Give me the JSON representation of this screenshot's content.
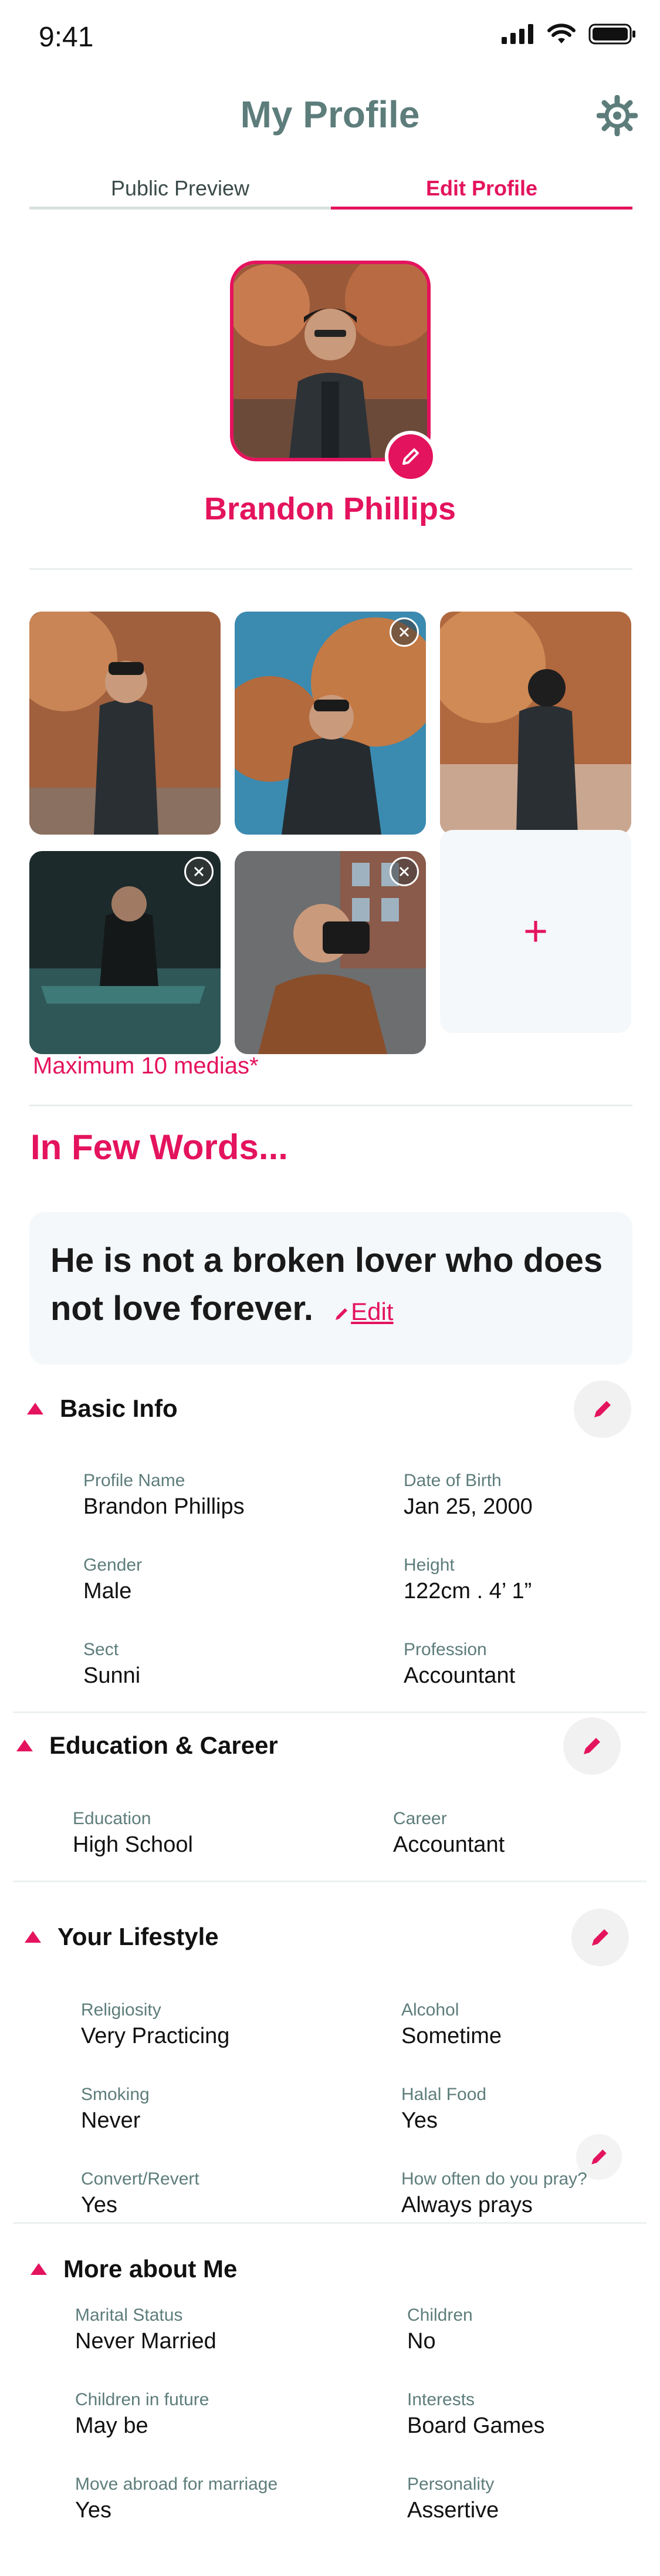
{
  "status": {
    "time": "9:41"
  },
  "header": {
    "title": "My Profile"
  },
  "tabs": {
    "left": "Public Preview",
    "right": "Edit Profile"
  },
  "profile": {
    "name": "Brandon Phillips"
  },
  "media": {
    "note": "Maximum 10 medias*",
    "add_label": "+"
  },
  "about": {
    "headline": "In Few Words...",
    "quote": "He is not a broken lover who does not love forever.",
    "edit_label": "Edit"
  },
  "basic_info": {
    "title": "Basic Info",
    "fields": [
      {
        "label": "Profile Name",
        "value": "Brandon Phillips"
      },
      {
        "label": "Date of Birth",
        "value": " Jan 25, 2000"
      },
      {
        "label": "Gender",
        "value": "Male"
      },
      {
        "label": "Height",
        "value": "122cm . 4’ 1”"
      },
      {
        "label": "Sect",
        "value": "Sunni"
      },
      {
        "label": "Profession",
        "value": "Accountant"
      }
    ]
  },
  "education": {
    "title": "Education & Career",
    "fields": [
      {
        "label": "Education",
        "value": "High School"
      },
      {
        "label": "Career",
        "value": "Accountant"
      }
    ]
  },
  "lifestyle": {
    "title": "Your Lifestyle",
    "fields": [
      {
        "label": "Religiosity",
        "value": "Very Practicing"
      },
      {
        "label": "Alcohol",
        "value": "Sometime"
      },
      {
        "label": "Smoking",
        "value": "Never"
      },
      {
        "label": "Halal Food",
        "value": "Yes"
      },
      {
        "label": "Convert/Revert",
        "value": "Yes"
      },
      {
        "label": "How often do you pray?",
        "value": "Always prays"
      }
    ]
  },
  "more_about": {
    "title": "More about Me",
    "fields": [
      {
        "label": "Marital Status",
        "value": "Never Married"
      },
      {
        "label": "Children",
        "value": "No"
      },
      {
        "label": "Children in future",
        "value": "May be"
      },
      {
        "label": "Interests",
        "value": "Board Games"
      },
      {
        "label": "Move abroad for marriage",
        "value": "Yes"
      },
      {
        "label": "Personality",
        "value": "Assertive"
      }
    ]
  },
  "colors": {
    "accent": "#e4135d",
    "teal": "#5d7d7b",
    "card": "#f5f8fa"
  }
}
